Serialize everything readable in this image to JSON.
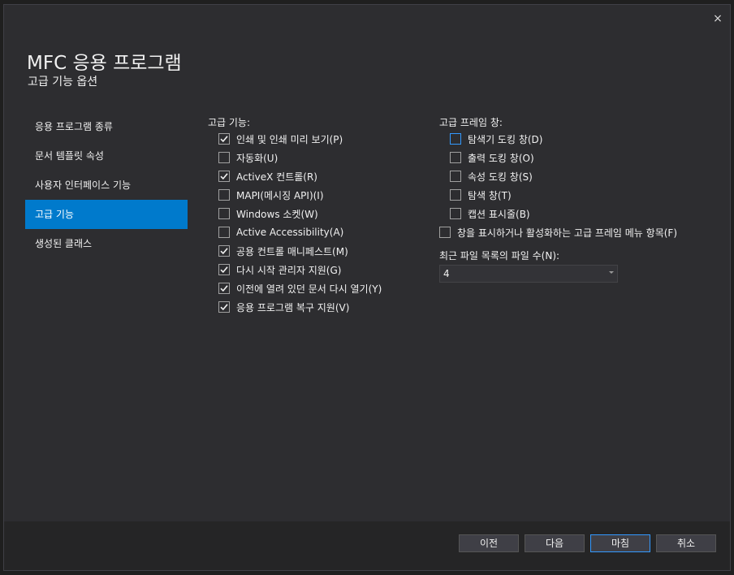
{
  "dialog": {
    "title": "MFC 응용 프로그램",
    "subtitle": "고급 기능 옵션",
    "close_icon": "×"
  },
  "nav": {
    "items": [
      {
        "label": "응용 프로그램 종류",
        "active": false
      },
      {
        "label": "문서 템플릿 속성",
        "active": false
      },
      {
        "label": "사용자 인터페이스 기능",
        "active": false
      },
      {
        "label": "고급 기능",
        "active": true
      },
      {
        "label": "생성된 클래스",
        "active": false
      }
    ]
  },
  "advanced": {
    "label": "고급 기능:",
    "items": [
      {
        "label": "인쇄 및 인쇄 미리 보기(P)",
        "checked": true
      },
      {
        "label": "자동화(U)",
        "checked": false
      },
      {
        "label": "ActiveX 컨트롤(R)",
        "checked": true
      },
      {
        "label": "MAPI(메시징 API)(I)",
        "checked": false
      },
      {
        "label": "Windows 소켓(W)",
        "checked": false
      },
      {
        "label": "Active Accessibility(A)",
        "checked": false
      },
      {
        "label": "공용 컨트롤 매니페스트(M)",
        "checked": true
      },
      {
        "label": "다시 시작 관리자 지원(G)",
        "checked": true
      },
      {
        "label": "이전에 열려 있던 문서 다시 열기(Y)",
        "checked": true
      },
      {
        "label": "응용 프로그램 복구 지원(V)",
        "checked": true
      }
    ]
  },
  "frame": {
    "label": "고급 프레임 창:",
    "items": [
      {
        "label": "탐색기 도킹 창(D)",
        "checked": false
      },
      {
        "label": "출력 도킹 창(O)",
        "checked": false
      },
      {
        "label": "속성 도킹 창(S)",
        "checked": false
      },
      {
        "label": "탐색 창(T)",
        "checked": false
      },
      {
        "label": "캡션 표시줄(B)",
        "checked": false
      }
    ],
    "menu_option": {
      "label": "창을 표시하거나 활성화하는 고급 프레임 메뉴 항목(F)",
      "checked": false
    }
  },
  "mru": {
    "label": "최근 파일 목록의 파일 수(N):",
    "value": "4"
  },
  "footer": {
    "prev": "이전",
    "next": "다음",
    "finish": "마침",
    "cancel": "취소"
  },
  "colors": {
    "accent": "#007acc",
    "focus": "#3399ff",
    "background": "#2d2d30"
  }
}
